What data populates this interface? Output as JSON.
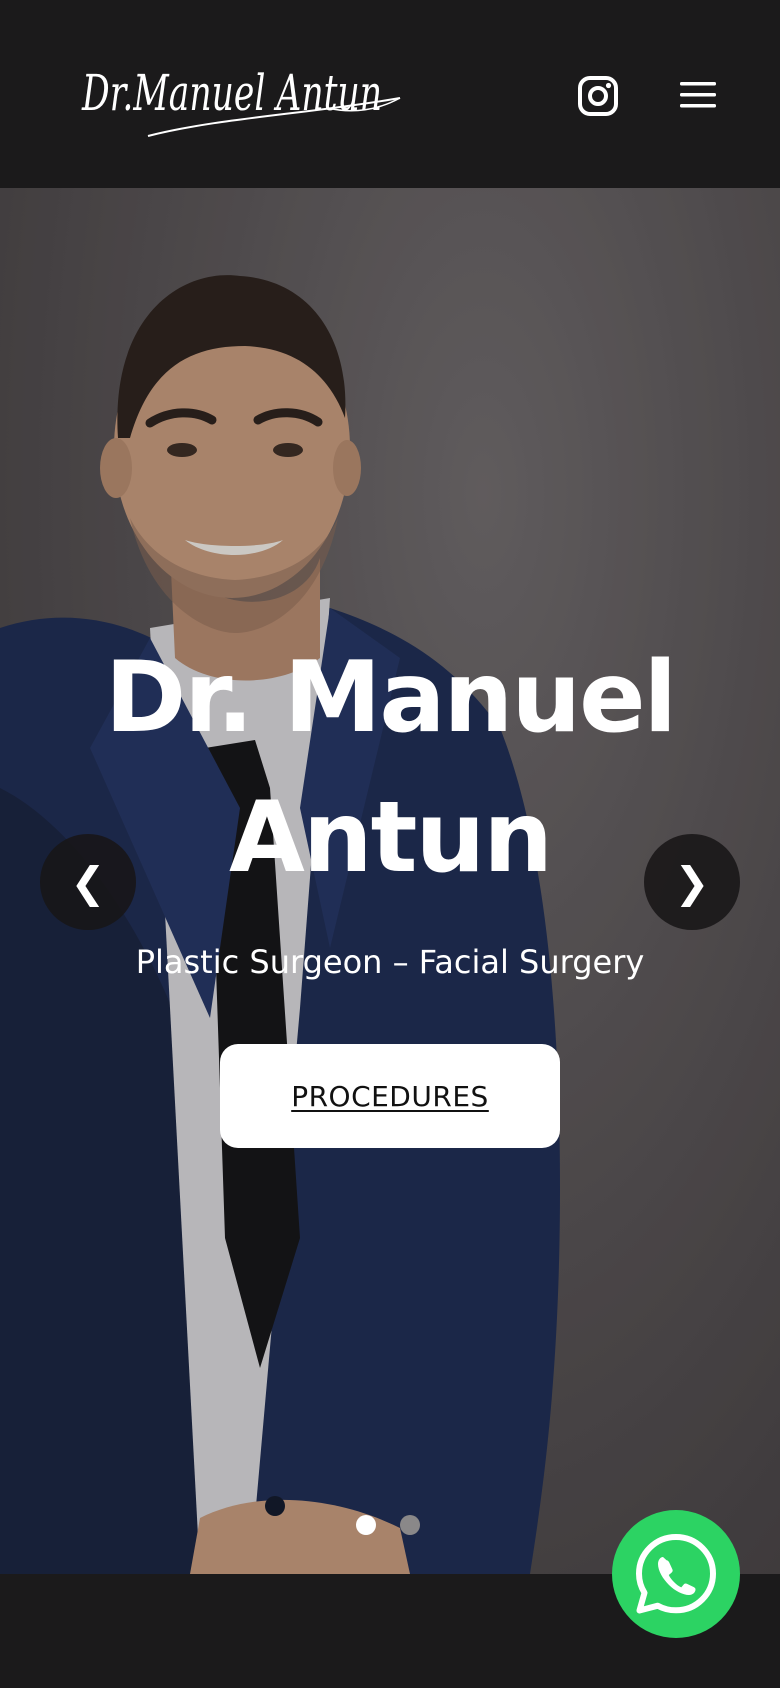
{
  "header": {
    "logo_text": "Dr.Manuel Antun",
    "instagram_icon": "instagram-icon",
    "menu_icon": "hamburger-menu-icon"
  },
  "hero": {
    "title_line1": "Dr. Manuel",
    "title_line2": "Antun",
    "subtitle": "Plastic Surgeon – Facial Surgery",
    "cta_label": "PROCEDURES",
    "prev_arrow": "❮",
    "next_arrow": "❯",
    "slides_count": 2,
    "active_slide": 1
  },
  "floating": {
    "whatsapp_icon": "whatsapp-icon"
  },
  "colors": {
    "header_bg": "#1b1a1b",
    "cta_bg": "#ffffff",
    "whatsapp_green": "#2cd363",
    "suit_navy": "#1c2a52"
  }
}
